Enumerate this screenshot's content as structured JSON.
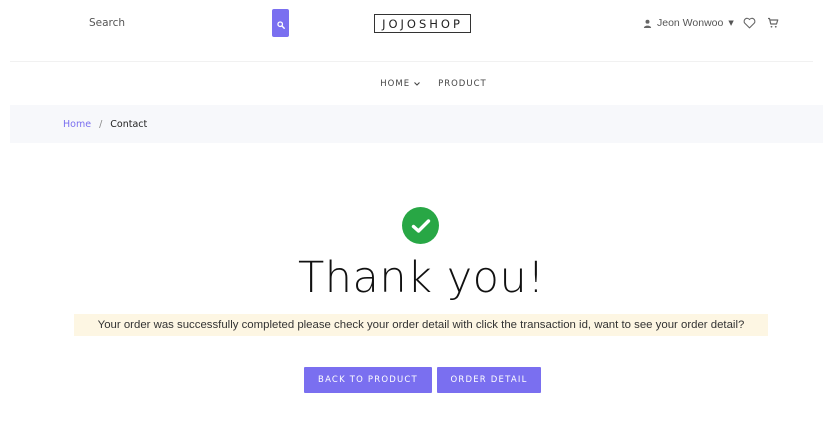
{
  "header": {
    "search_placeholder": "Search",
    "logo_text": "JOJOSHOP",
    "user_name": "Jeon Wonwoo",
    "icons": {
      "search": "search-icon",
      "user": "user-icon",
      "caret": "caret-down-icon",
      "wishlist": "heart-icon",
      "cart": "cart-icon"
    }
  },
  "nav": {
    "items": [
      {
        "label": "HOME",
        "has_dropdown": true
      },
      {
        "label": "PRODUCT",
        "has_dropdown": false
      }
    ]
  },
  "breadcrumb": {
    "home": "Home",
    "separator": "/",
    "current": "Contact"
  },
  "main": {
    "icon": "check-circle-icon",
    "title": "Thank you!",
    "message": "Your order was successfully completed please check your order detail with click the transaction id, want to see your order detail?",
    "buttons": {
      "back": "BACK TO PRODUCT",
      "detail": "ORDER DETAIL"
    }
  },
  "colors": {
    "accent": "#7a6ff0",
    "success": "#28a745",
    "message_bg": "#fdf6e3",
    "breadcrumb_bg": "#f7f8fb"
  }
}
